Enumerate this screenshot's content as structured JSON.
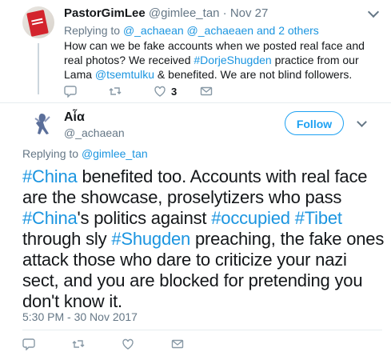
{
  "parent_tweet": {
    "author_name": "PastorGimLee",
    "author_handle": "@gimlee_tan",
    "separator": "·",
    "time": "Nov 27",
    "replying_prefix": "Replying to",
    "replying_users": [
      "@_achaean",
      "@_achaeaen"
    ],
    "replying_suffix": "and 2 others",
    "text_parts": [
      "How can we be fake accounts when we posted real face and real photos? We received ",
      "#DorjeShugden",
      " practice from our Lama ",
      "@tsemtulku",
      " & benefited. We are not blind followers."
    ],
    "like_count": "3"
  },
  "main_tweet": {
    "author_name": "Aἷα",
    "author_handle": "@_achaean",
    "follow_label": "Follow",
    "replying_prefix": "Replying to",
    "replying_user": "@gimlee_tan",
    "text_parts": [
      "#China",
      " benefited too. Accounts with real face are the showcase, proselytizers who pass ",
      "#China",
      "'s politics against ",
      "#occupied",
      " ",
      "#Tibet",
      " through sly ",
      "#Shugden",
      " preaching, the fake ones attack those who dare to criticize your nazi sect, and you are blocked for pretending you don't know it."
    ],
    "timestamp": "5:30 PM - 30 Nov 2017"
  },
  "icons": {
    "reply": "reply-icon",
    "retweet": "retweet-icon",
    "like": "heart-icon",
    "dm": "envelope-icon",
    "more": "chevron-down-icon"
  },
  "colors": {
    "link": "#1b95e0",
    "follow": "#1da1f2",
    "secondary": "#657786",
    "text": "#14171a"
  }
}
